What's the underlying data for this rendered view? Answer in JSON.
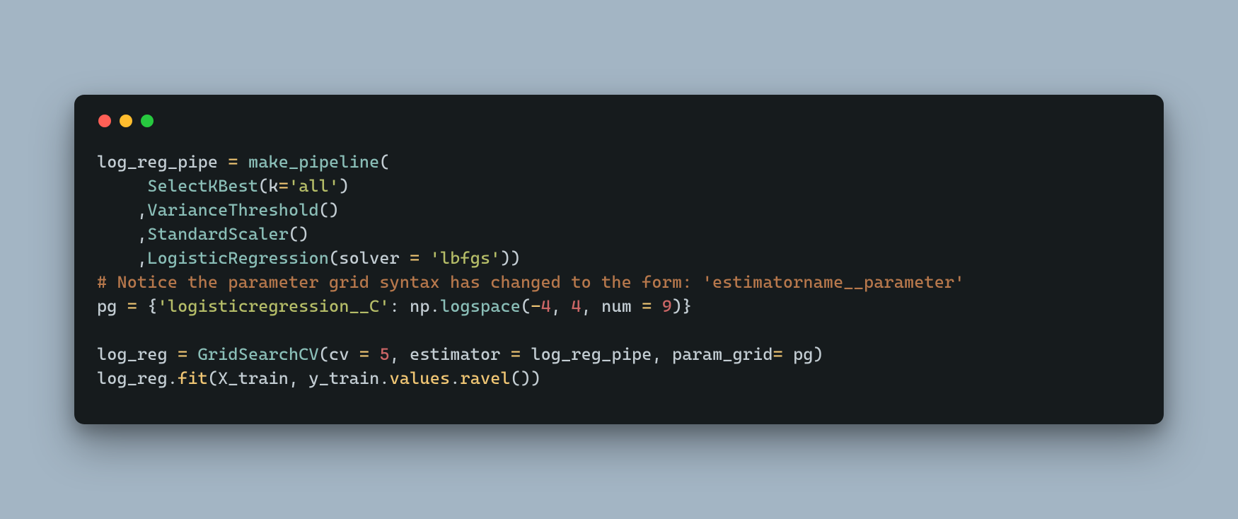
{
  "colors": {
    "background": "#a3b5c4",
    "window_bg": "#161b1d",
    "dot_red": "#ff5f56",
    "dot_yellow": "#ffbd2e",
    "dot_green": "#27c93f",
    "text_default": "#c3cdd3",
    "text_func": "#8abeb7",
    "text_keyword": "#f0c674",
    "text_string": "#b5bd68",
    "text_number": "#cc6666",
    "text_comment": "#b7784c"
  },
  "code": {
    "tokens": [
      [
        {
          "t": "log_reg_pipe ",
          "c": "default"
        },
        {
          "t": "=",
          "c": "kw"
        },
        {
          "t": " ",
          "c": "default"
        },
        {
          "t": "make_pipeline",
          "c": "func"
        },
        {
          "t": "(",
          "c": "punct"
        }
      ],
      [
        {
          "t": "     ",
          "c": "default"
        },
        {
          "t": "SelectKBest",
          "c": "func"
        },
        {
          "t": "(k",
          "c": "punct"
        },
        {
          "t": "=",
          "c": "kw"
        },
        {
          "t": "'all'",
          "c": "string"
        },
        {
          "t": ")",
          "c": "punct"
        }
      ],
      [
        {
          "t": "    ,",
          "c": "punct"
        },
        {
          "t": "VarianceThreshold",
          "c": "func"
        },
        {
          "t": "()",
          "c": "punct"
        }
      ],
      [
        {
          "t": "    ,",
          "c": "punct"
        },
        {
          "t": "StandardScaler",
          "c": "func"
        },
        {
          "t": "()",
          "c": "punct"
        }
      ],
      [
        {
          "t": "    ,",
          "c": "punct"
        },
        {
          "t": "LogisticRegression",
          "c": "func"
        },
        {
          "t": "(solver ",
          "c": "punct"
        },
        {
          "t": "=",
          "c": "kw"
        },
        {
          "t": " ",
          "c": "default"
        },
        {
          "t": "'lbfgs'",
          "c": "string"
        },
        {
          "t": "))",
          "c": "punct"
        }
      ],
      [
        {
          "t": "# Notice the parameter grid syntax has changed to the form: 'estimatorname__parameter'",
          "c": "comment"
        }
      ],
      [
        {
          "t": "pg ",
          "c": "default"
        },
        {
          "t": "=",
          "c": "kw"
        },
        {
          "t": " {",
          "c": "punct"
        },
        {
          "t": "'logisticregression__C'",
          "c": "string"
        },
        {
          "t": ": np.",
          "c": "punct"
        },
        {
          "t": "logspace",
          "c": "func"
        },
        {
          "t": "(",
          "c": "punct"
        },
        {
          "t": "-",
          "c": "kw"
        },
        {
          "t": "4",
          "c": "num"
        },
        {
          "t": ", ",
          "c": "punct"
        },
        {
          "t": "4",
          "c": "num"
        },
        {
          "t": ", num ",
          "c": "punct"
        },
        {
          "t": "=",
          "c": "kw"
        },
        {
          "t": " ",
          "c": "default"
        },
        {
          "t": "9",
          "c": "num"
        },
        {
          "t": ")}",
          "c": "punct"
        }
      ],
      [
        {
          "t": "",
          "c": "default"
        }
      ],
      [
        {
          "t": "log_reg ",
          "c": "default"
        },
        {
          "t": "=",
          "c": "kw"
        },
        {
          "t": " ",
          "c": "default"
        },
        {
          "t": "GridSearchCV",
          "c": "func"
        },
        {
          "t": "(cv ",
          "c": "punct"
        },
        {
          "t": "=",
          "c": "kw"
        },
        {
          "t": " ",
          "c": "default"
        },
        {
          "t": "5",
          "c": "num"
        },
        {
          "t": ", estimator ",
          "c": "punct"
        },
        {
          "t": "=",
          "c": "kw"
        },
        {
          "t": " log_reg_pipe, param_grid",
          "c": "default"
        },
        {
          "t": "=",
          "c": "kw"
        },
        {
          "t": " pg)",
          "c": "punct"
        }
      ],
      [
        {
          "t": "log_reg.",
          "c": "default"
        },
        {
          "t": "fit",
          "c": "attr"
        },
        {
          "t": "(X_train, y_train.",
          "c": "punct"
        },
        {
          "t": "values",
          "c": "attr"
        },
        {
          "t": ".",
          "c": "punct"
        },
        {
          "t": "ravel",
          "c": "attr"
        },
        {
          "t": "())",
          "c": "punct"
        }
      ]
    ]
  }
}
